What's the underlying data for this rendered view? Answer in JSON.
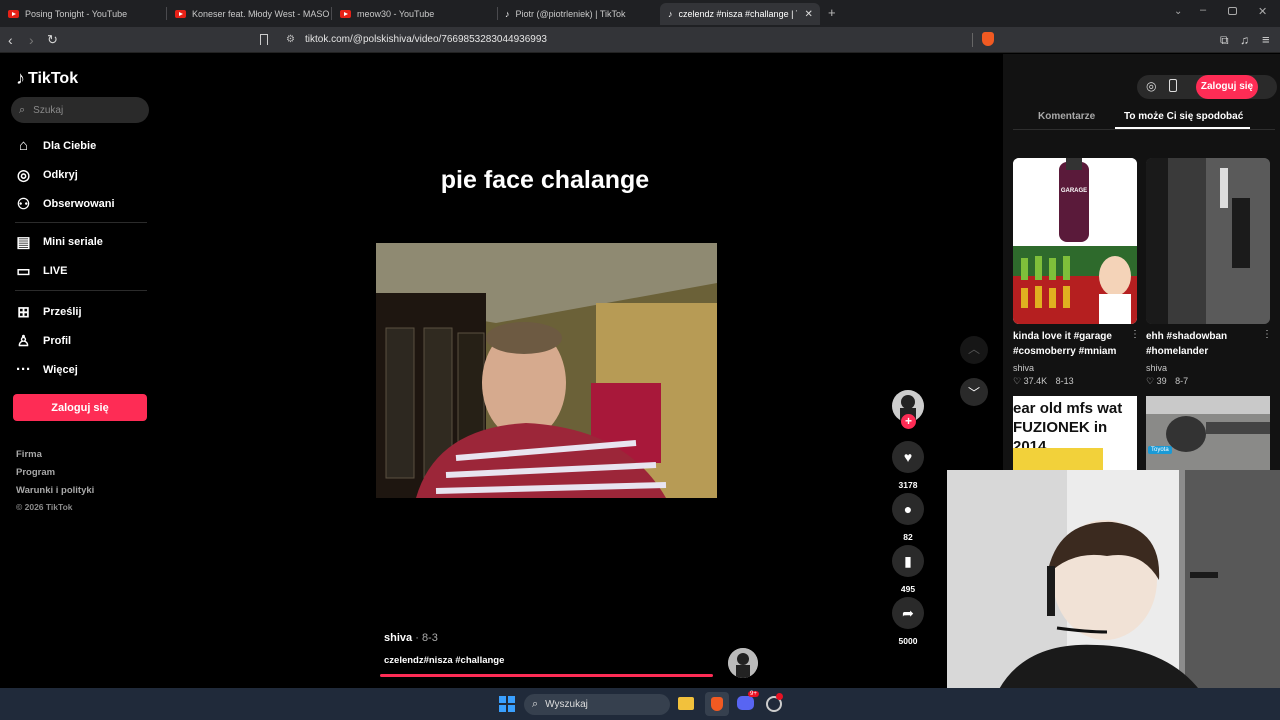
{
  "browser": {
    "tabs": [
      {
        "title": "Posing Tonight - YouTube",
        "icon": "youtube-icon"
      },
      {
        "title": "Koneser feat. Młody West - MASON",
        "icon": "youtube-icon"
      },
      {
        "title": "meow30 - YouTube",
        "icon": "youtube-icon"
      },
      {
        "title": "Piotr (@piotrleniek) | TikTok",
        "icon": "tiktok-icon"
      },
      {
        "title": "czelendz #nisza #challange | TikT",
        "icon": "tiktok-icon"
      }
    ],
    "url": "tiktok.com/@polskishiva/video/7669853283044936993"
  },
  "sidebar": {
    "logo": "TikTok",
    "search_placeholder": "Szukaj",
    "nav": [
      {
        "label": "Dla Ciebie",
        "icon": "home-icon"
      },
      {
        "label": "Odkryj",
        "icon": "compass-icon"
      },
      {
        "label": "Obserwowani",
        "icon": "user-follow-icon"
      },
      {
        "label": "Mini seriale",
        "icon": "film-icon"
      },
      {
        "label": "LIVE",
        "icon": "tv-icon"
      },
      {
        "label": "Prześlij",
        "icon": "plus-box-icon"
      },
      {
        "label": "Profil",
        "icon": "person-icon"
      },
      {
        "label": "Więcej",
        "icon": "more-icon"
      }
    ],
    "login_label": "Zaloguj się",
    "footer": [
      "Firma",
      "Program",
      "Warunki i polityki",
      "© 2026 TikTok"
    ]
  },
  "video": {
    "caption_overlay": "pie face chalange",
    "author": "shiva",
    "date": "8-3",
    "description": "czelendz#nisza #challange",
    "likes": "3178",
    "comments": "82",
    "saves": "495",
    "shares": "5000"
  },
  "right_panel": {
    "login_label": "Zaloguj się",
    "tabs": [
      "Komentarze",
      "To może Ci się spodobać"
    ],
    "active_tab": 1,
    "cards": [
      {
        "title": "kinda love it #garage #cosmoberry #mniam",
        "author": "shiva",
        "likes": "37.4K",
        "date": "8-13",
        "thumb_text": "GARAGE"
      },
      {
        "title": "ehh #shadowban #homelander",
        "author": "shiva",
        "likes": "39",
        "date": "8-7"
      },
      {
        "thumb_text": "ear old mfs wat FUZIONEK in 2014"
      },
      {
        "thumb_text": "Toyota"
      }
    ]
  },
  "taskbar": {
    "search_placeholder": "Wyszukaj",
    "discord_badge": "9+"
  },
  "colors": {
    "accent": "#fe2c55",
    "background": "#000000",
    "panel": "#121212"
  }
}
